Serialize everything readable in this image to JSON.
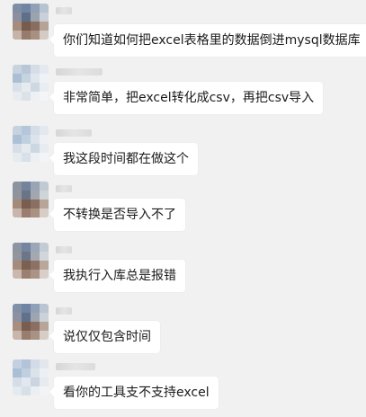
{
  "messages": [
    {
      "text": "你们知道如何把excel表格里的数据倒进mysql数据库"
    },
    {
      "text": "非常简单，把excel转化成csv，再把csv导入"
    },
    {
      "text": "我这段时间都在做这个"
    },
    {
      "text": "不转换是否导入不了"
    },
    {
      "text": "我执行入库总是报错"
    },
    {
      "text": "说仅仅包含时间"
    },
    {
      "text": "看你的工具支不支持excel"
    }
  ]
}
